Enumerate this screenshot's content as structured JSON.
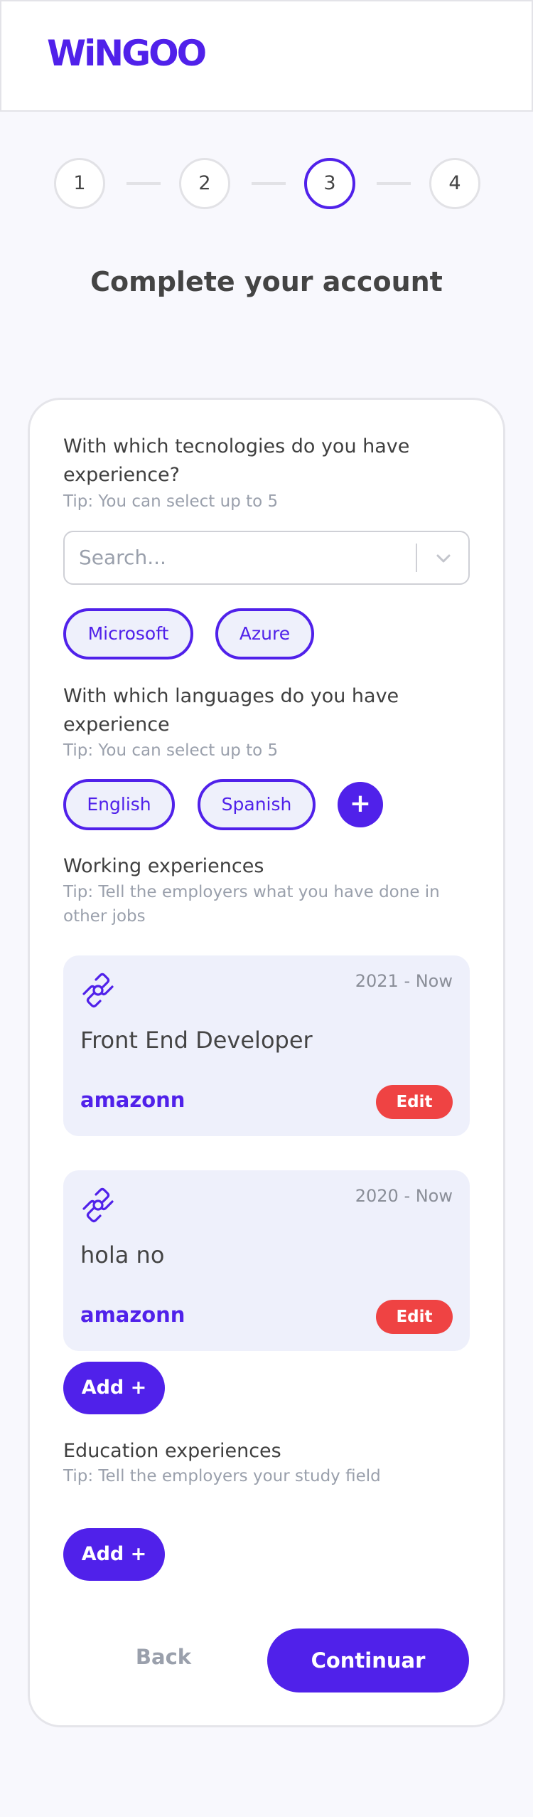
{
  "brand": {
    "logo": "WiNGOO",
    "accent": "#5021ea",
    "danger": "#ef4343"
  },
  "stepper": {
    "steps": [
      "1",
      "2",
      "3",
      "4"
    ],
    "current_step": "3"
  },
  "page_title": "Complete your account",
  "technologies": {
    "question": "With which tecnologies do you have experience?",
    "tip": "Tip: You can select up to 5",
    "search_placeholder": "Search...",
    "selected": [
      "Microsoft",
      "Azure"
    ]
  },
  "languages": {
    "question": "With which languages do you have experience",
    "tip": "Tip: You can select up to 5",
    "selected": [
      "English",
      "Spanish"
    ],
    "add_label": "+"
  },
  "working": {
    "title": "Working experiences",
    "tip": "Tip: Tell the employers what you have done in other jobs",
    "items": [
      {
        "date": "2021 - Now",
        "title": "Front End Developer",
        "company": "amazonn",
        "edit_label": "Edit",
        "icon": "link-icon"
      },
      {
        "date": "2020 - Now",
        "title": "hola no",
        "company": "amazonn",
        "edit_label": "Edit",
        "icon": "link-icon"
      }
    ],
    "add_label": "Add +"
  },
  "education": {
    "title": "Education experiences",
    "tip": "Tip: Tell the employers your study field",
    "add_label": "Add +"
  },
  "footer": {
    "back_label": "Back",
    "continue_label": "Continuar"
  }
}
